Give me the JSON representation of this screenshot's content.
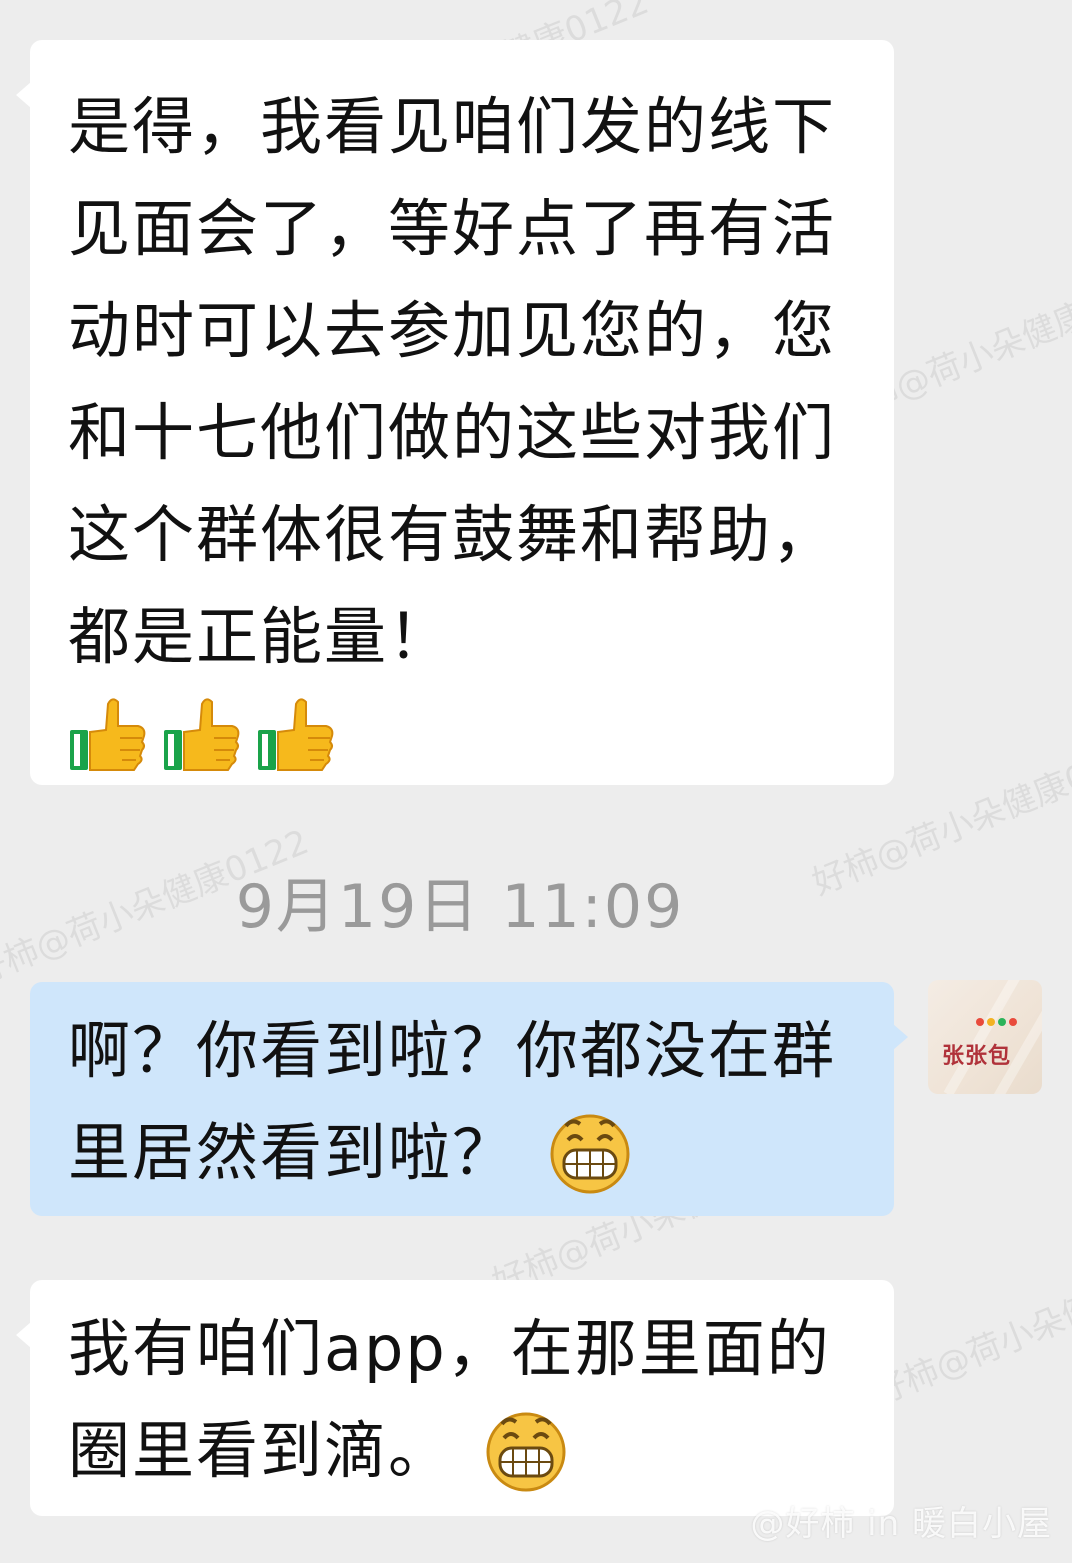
{
  "watermark_text": "好柿@荷小朵健康0122",
  "messages": [
    {
      "sender": "other",
      "text": "是得，我看见咱们发的线下见面会了，等好点了再有活动时可以去参加见您的，您和十七他们做的这些对我们这个群体很有鼓舞和帮助，都是正能量！",
      "emoji_trail": [
        "thumbs-up",
        "thumbs-up",
        "thumbs-up"
      ]
    },
    {
      "sender": "me",
      "text": "啊？你看到啦？你都没在群里居然看到啦？",
      "emoji_trail": [
        "grinning-face"
      ]
    },
    {
      "sender": "other",
      "text": "我有咱们app，在那里面的圈里看到滴。",
      "emoji_trail": [
        "grinning-face"
      ]
    }
  ],
  "timestamp": "9月19日  11:09",
  "avatar": {
    "label": "张张包"
  },
  "footer_mark": "@好柿 in 暖白小屋",
  "colors": {
    "background": "#ededed",
    "incoming_bubble": "#ffffff",
    "outgoing_bubble": "#cfe6fb",
    "timestamp": "#9a9a9a"
  }
}
